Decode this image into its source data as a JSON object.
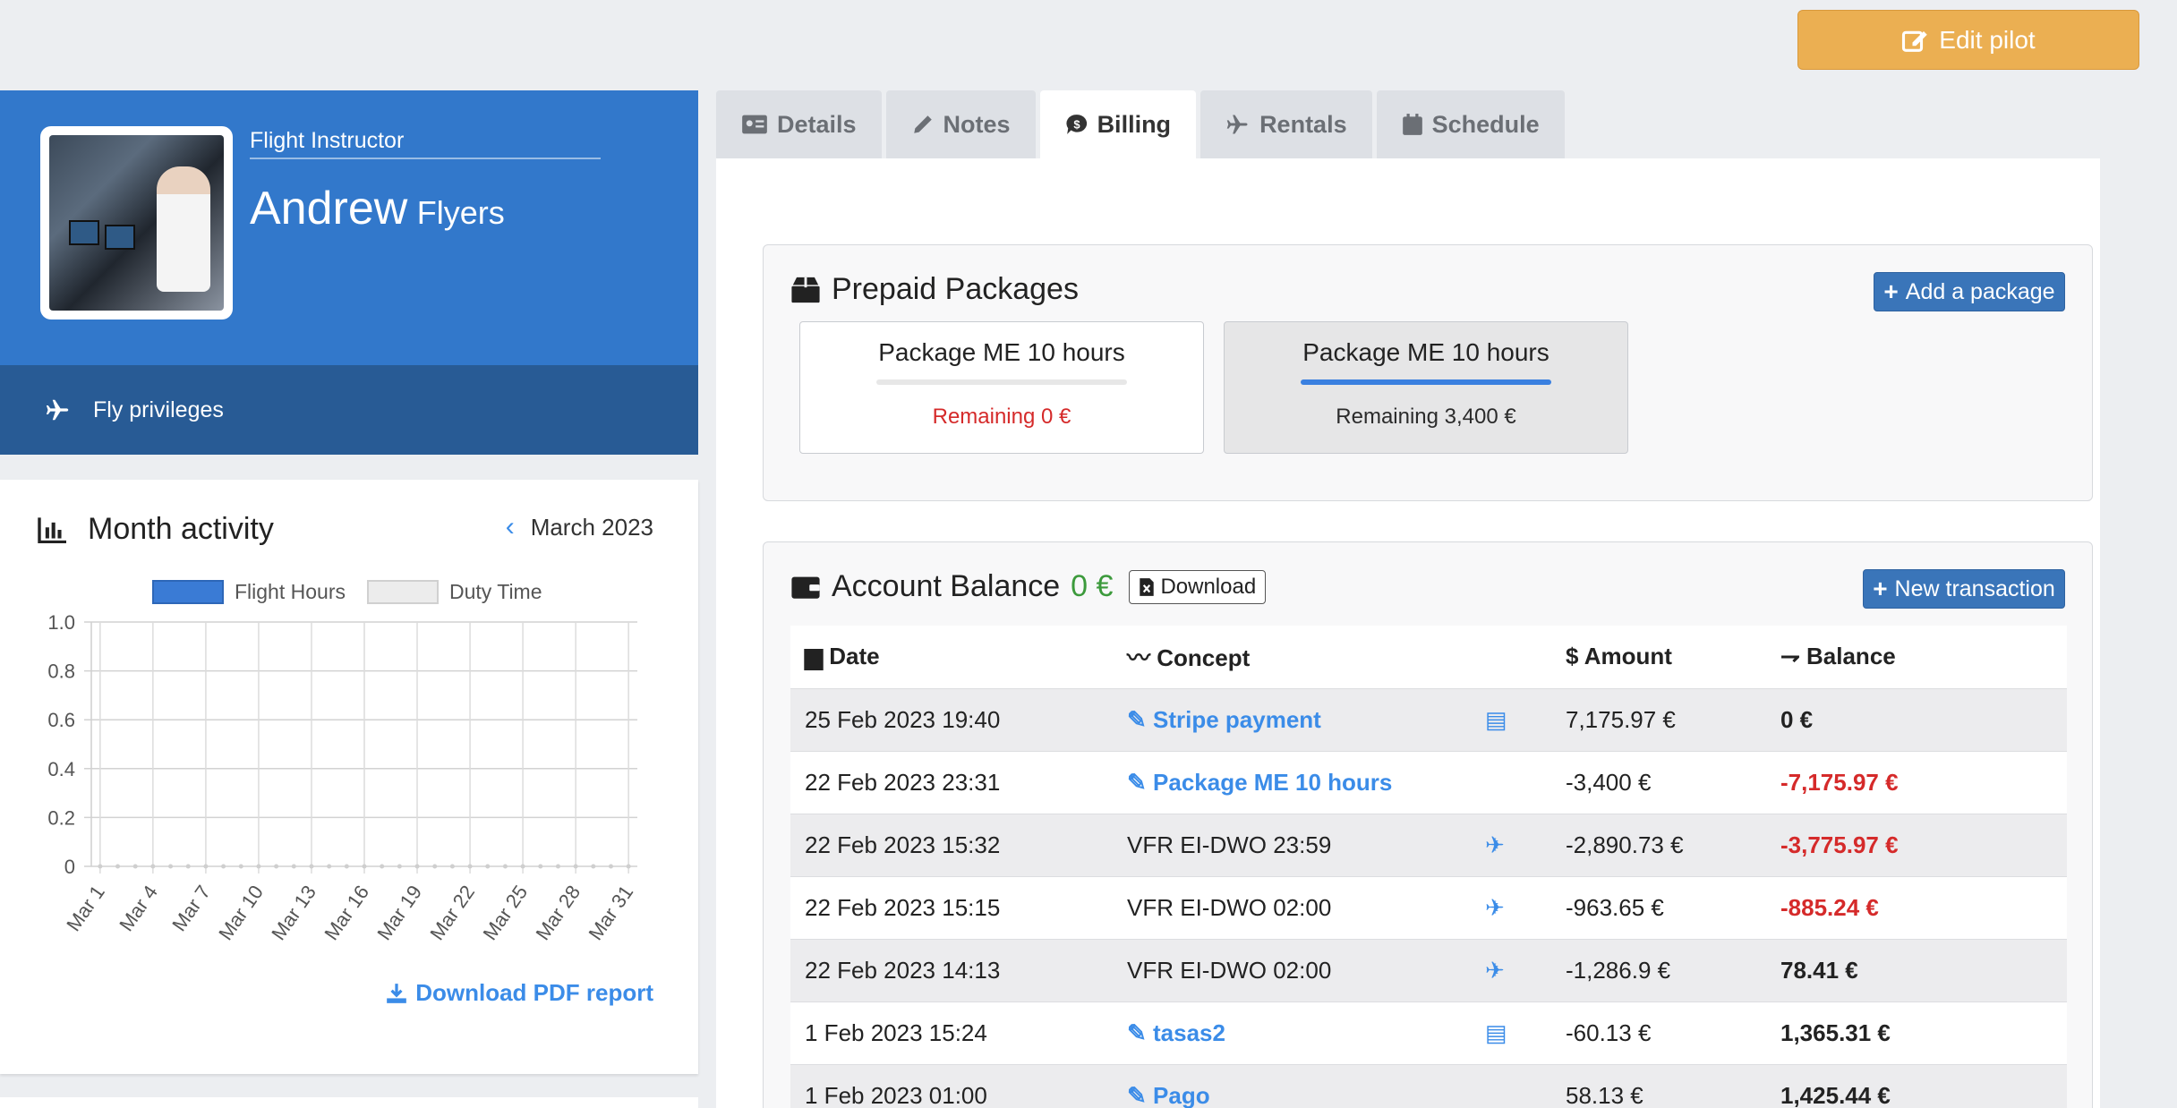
{
  "header": {
    "edit_label": "Edit pilot"
  },
  "profile": {
    "role": "Flight Instructor",
    "first_name": "Andrew",
    "last_name": "Flyers",
    "privileges_label": "Fly privileges"
  },
  "activity": {
    "title": "Month activity",
    "month": "March 2023",
    "legend": [
      "Flight Hours",
      "Duty Time"
    ],
    "download_label": "Download PDF report"
  },
  "chart_data": {
    "type": "bar",
    "categories": [
      "Mar 1",
      "Mar 2",
      "Mar 3",
      "Mar 4",
      "Mar 5",
      "Mar 6",
      "Mar 7",
      "Mar 8",
      "Mar 9",
      "Mar 10",
      "Mar 11",
      "Mar 12",
      "Mar 13",
      "Mar 14",
      "Mar 15",
      "Mar 16",
      "Mar 17",
      "Mar 18",
      "Mar 19",
      "Mar 20",
      "Mar 21",
      "Mar 22",
      "Mar 23",
      "Mar 24",
      "Mar 25",
      "Mar 26",
      "Mar 27",
      "Mar 28",
      "Mar 29",
      "Mar 30",
      "Mar 31"
    ],
    "tick_labels": [
      "Mar 1",
      "Mar 4",
      "Mar 7",
      "Mar 10",
      "Mar 13",
      "Mar 16",
      "Mar 19",
      "Mar 22",
      "Mar 25",
      "Mar 28",
      "Mar 31"
    ],
    "series": [
      {
        "name": "Flight Hours",
        "values": [
          0,
          0,
          0,
          0,
          0,
          0,
          0,
          0,
          0,
          0,
          0,
          0,
          0,
          0,
          0,
          0,
          0,
          0,
          0,
          0,
          0,
          0,
          0,
          0,
          0,
          0,
          0,
          0,
          0,
          0,
          0
        ]
      },
      {
        "name": "Duty Time",
        "values": [
          0,
          0,
          0,
          0,
          0,
          0,
          0,
          0,
          0,
          0,
          0,
          0,
          0,
          0,
          0,
          0,
          0,
          0,
          0,
          0,
          0,
          0,
          0,
          0,
          0,
          0,
          0,
          0,
          0,
          0,
          0
        ]
      }
    ],
    "y_ticks": [
      "1.0",
      "0.8",
      "0.6",
      "0.4",
      "0.2",
      "0"
    ],
    "ylim": [
      0,
      1
    ],
    "grid": true,
    "legend_position": "top"
  },
  "tabs": [
    {
      "label": "Details",
      "icon": "id-card-icon"
    },
    {
      "label": "Notes",
      "icon": "pencil-icon"
    },
    {
      "label": "Billing",
      "icon": "billing-icon"
    },
    {
      "label": "Rentals",
      "icon": "plane-icon"
    },
    {
      "label": "Schedule",
      "icon": "calendar-icon"
    }
  ],
  "packages": {
    "title": "Prepaid Packages",
    "add_label": "Add a package",
    "items": [
      {
        "name": "Package ME 10 hours",
        "remaining": "Remaining 0 €"
      },
      {
        "name": "Package ME 10 hours",
        "remaining": "Remaining 3,400 €"
      }
    ]
  },
  "balance": {
    "title": "Account Balance",
    "amount": "0 €",
    "download_label": "Download",
    "new_label": "New transaction",
    "columns": [
      "Date",
      "Concept",
      "Amount",
      "Balance"
    ],
    "rows": [
      {
        "date": "25 Feb 2023 19:40",
        "concept": "Stripe payment",
        "amount": "7,175.97 €",
        "balance": "0 €"
      },
      {
        "date": "22 Feb 2023 23:31",
        "concept": "Package ME 10 hours",
        "amount": "-3,400 €",
        "balance": "-7,175.97 €"
      },
      {
        "date": "22 Feb 2023 15:32",
        "concept": "VFR EI-DWO 23:59",
        "amount": "-2,890.73 €",
        "balance": "-3,775.97 €"
      },
      {
        "date": "22 Feb 2023 15:15",
        "concept": "VFR EI-DWO 02:00",
        "amount": "-963.65 €",
        "balance": "-885.24 €"
      },
      {
        "date": "22 Feb 2023 14:13",
        "concept": "VFR EI-DWO 02:00",
        "amount": "-1,286.9 €",
        "balance": "78.41 €"
      },
      {
        "date": "1 Feb 2023 15:24",
        "concept": "tasas2",
        "amount": "-60.13 €",
        "balance": "1,365.31 €"
      },
      {
        "date": "1 Feb 2023 01:00",
        "concept": "Pago",
        "amount": "58.13 €",
        "balance": "1,425.44 €"
      }
    ]
  }
}
